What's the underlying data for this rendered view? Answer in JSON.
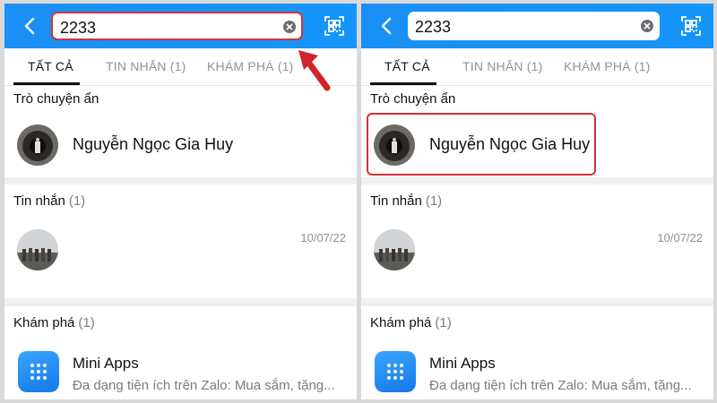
{
  "search": {
    "query": "2233"
  },
  "tabs": [
    {
      "label": "TẤT CẢ"
    },
    {
      "label": "TIN NHẮN (1)"
    },
    {
      "label": "KHÁM PHÁ (1)"
    }
  ],
  "hidden_chats": {
    "title": "Trò chuyện ẩn",
    "contact_name": "Nguyễn Ngọc Gia Huy"
  },
  "messages": {
    "title": "Tin nhắn",
    "count": "(1)",
    "date": "10/07/22"
  },
  "explore": {
    "title": "Khám phá",
    "count": "(1)",
    "app_name": "Mini Apps",
    "app_desc": "Đa dạng tiện ích trên Zalo: Mua sắm, tặng..."
  },
  "colors": {
    "header_blue": "#1a8ff5",
    "highlight_red": "#d6303a",
    "arrow_red": "#d2232a"
  },
  "icons": [
    "back-icon",
    "clear-icon",
    "qr-scan-icon",
    "arrow-icon",
    "mini-apps-grid-icon"
  ]
}
